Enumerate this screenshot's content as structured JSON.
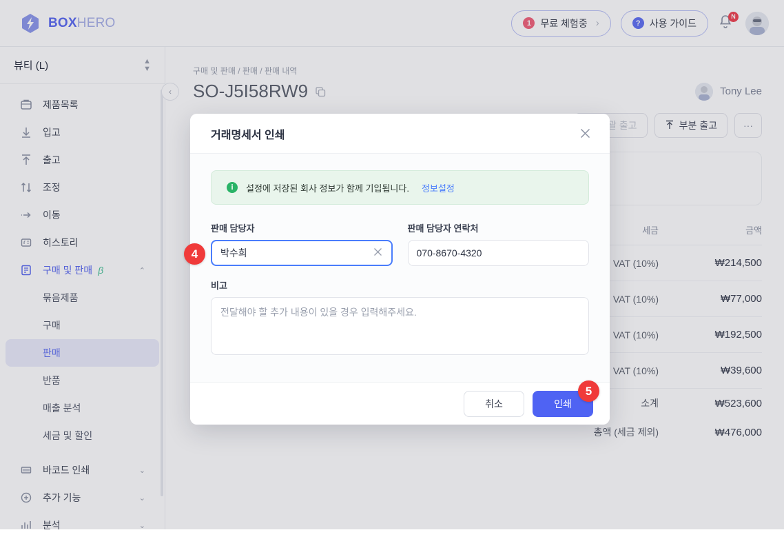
{
  "app": {
    "logo": {
      "bold": "BOX",
      "light": "HERO",
      "icon": "hexagon-bolt-logo"
    }
  },
  "topbar": {
    "trial_badge": "1",
    "trial_label": "무료 체험중",
    "trial_chevron": "›",
    "guide_badge": "?",
    "guide_label": "사용 가이드",
    "bell_icon": "bell-icon",
    "bell_badge": "N",
    "avatar": "user-avatar"
  },
  "sidebar": {
    "workspace": "뷰티 (L)",
    "collapse_icon": "‹",
    "items": [
      {
        "label": "제품목록",
        "icon": "box-icon",
        "active": false
      },
      {
        "label": "입고",
        "icon": "arrow-down-icon",
        "active": false
      },
      {
        "label": "출고",
        "icon": "arrow-up-icon",
        "active": false
      },
      {
        "label": "조정",
        "icon": "arrows-updown-icon",
        "active": false
      },
      {
        "label": "이동",
        "icon": "arrow-right-dotted-icon",
        "active": false
      },
      {
        "label": "히스토리",
        "icon": "history-icon",
        "active": false
      },
      {
        "label": "구매 및 판매",
        "icon": "list-doc-icon",
        "active": true,
        "beta": "β",
        "caret": "⌃"
      }
    ],
    "sub_items": [
      {
        "label": "묶음제품",
        "active": false
      },
      {
        "label": "구매",
        "active": false
      },
      {
        "label": "판매",
        "active": true
      },
      {
        "label": "반품",
        "active": false
      },
      {
        "label": "매출 분석",
        "active": false
      },
      {
        "label": "세금 및 할인",
        "active": false
      }
    ],
    "groups": [
      {
        "label": "바코드 인쇄",
        "icon": "barcode-icon",
        "caret": "⌄"
      },
      {
        "label": "추가 기능",
        "icon": "plus-circle-icon",
        "caret": "⌄"
      },
      {
        "label": "분석",
        "icon": "bar-chart-icon",
        "caret": "⌄"
      }
    ]
  },
  "main": {
    "breadcrumb": "구매 및 판매 / 판매 / 판매 내역",
    "page_title": "SO-J5I58RW9",
    "copy_icon": "copy-icon",
    "owner_name": "Tony Lee",
    "actions": [
      {
        "label": "일괄 출고",
        "icon": "check-icon",
        "disabled": true
      },
      {
        "label": "부분 출고",
        "icon": "arrow-up-icon",
        "disabled": false
      },
      {
        "label": "···",
        "icon": "more-horizontal-icon",
        "disabled": false
      }
    ],
    "table": {
      "headers": {
        "tax": "세금",
        "amount": "금액"
      },
      "rows": [
        {
          "tax": "VAT (10%)",
          "amount": "₩214,500"
        },
        {
          "tax": "VAT (10%)",
          "amount": "₩77,000"
        },
        {
          "tax": "VAT (10%)",
          "amount": "₩192,500"
        },
        {
          "tax": "VAT (10%)",
          "amount": "₩39,600"
        }
      ],
      "totals": [
        {
          "label": "소계",
          "amount": "₩523,600"
        },
        {
          "label": "총액 (세금 제외)",
          "amount": "₩476,000"
        }
      ]
    }
  },
  "modal": {
    "title": "거래명세서 인쇄",
    "close_icon": "close-icon",
    "banner": {
      "icon": "info-icon",
      "icon_glyph": "i",
      "text": "설정에 저장된 회사 정보가 함께 기입됩니다.",
      "link": "정보설정"
    },
    "fields": {
      "rep_label": "판매 담당자",
      "rep_value": "박수희",
      "rep_clear_icon": "clear-icon",
      "contact_label": "판매 담당자 연락처",
      "contact_value": "070-8670-4320",
      "note_label": "비고",
      "note_placeholder": "전달해야 할 추가 내용이 있을 경우 입력해주세요."
    },
    "cancel_label": "취소",
    "print_label": "인쇄"
  },
  "annotations": {
    "step4": "4",
    "step5": "5"
  },
  "colors": {
    "accent": "#4f63f3",
    "logo_bold": "#5b6af0",
    "badge_red": "#f03a3a",
    "banner_bg": "#e9f5ec",
    "banner_green": "#2ab367",
    "link_blue": "#4a7dfc"
  }
}
